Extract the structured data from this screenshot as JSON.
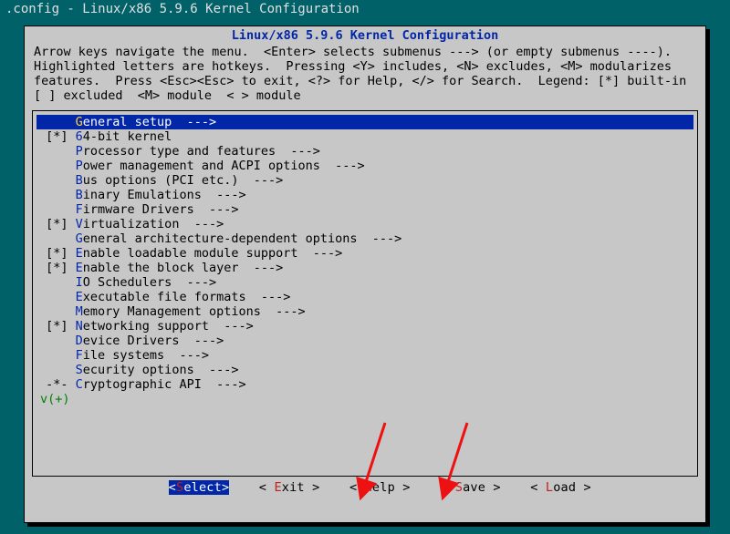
{
  "window_title": ".config - Linux/x86 5.9.6 Kernel Configuration",
  "box_title": "Linux/x86 5.9.6 Kernel Configuration",
  "help_text": "Arrow keys navigate the menu.  <Enter> selects submenus ---> (or empty submenus ----).  Highlighted letters are hotkeys.  Pressing <Y> includes, <N> excludes, <M> modularizes features.  Press <Esc><Esc> to exit, <?> for Help, </> for Search.  Legend: [*] built-in  [ ] excluded  <M> module  < > module",
  "menu": [
    {
      "marker": "   ",
      "hot": "G",
      "rest": "eneral setup  --->",
      "selected": true
    },
    {
      "marker": "[*]",
      "hot": "6",
      "rest": "4-bit kernel"
    },
    {
      "marker": "   ",
      "hot": "P",
      "rest": "rocessor type and features  --->"
    },
    {
      "marker": "   ",
      "hot": "P",
      "rest": "ower management and ACPI options  --->"
    },
    {
      "marker": "   ",
      "hot": "B",
      "rest": "us options (PCI etc.)  --->"
    },
    {
      "marker": "   ",
      "hot": "B",
      "rest": "inary Emulations  --->"
    },
    {
      "marker": "   ",
      "hot": "F",
      "rest": "irmware Drivers  --->"
    },
    {
      "marker": "[*]",
      "hot": "V",
      "rest": "irtualization  --->"
    },
    {
      "marker": "   ",
      "hot": "G",
      "rest": "eneral architecture-dependent options  --->"
    },
    {
      "marker": "[*]",
      "hot": "E",
      "rest": "nable loadable module support  --->"
    },
    {
      "marker": "[*]",
      "hot": "E",
      "rest": "nable the block layer  --->"
    },
    {
      "marker": "   ",
      "hot": "I",
      "rest": "O Schedulers  --->"
    },
    {
      "marker": "   ",
      "hot": "E",
      "rest": "xecutable file formats  --->"
    },
    {
      "marker": "   ",
      "hot": "M",
      "rest": "emory Management options  --->"
    },
    {
      "marker": "[*]",
      "hot": "N",
      "rest": "etworking support  --->"
    },
    {
      "marker": "   ",
      "hot": "D",
      "rest": "evice Drivers  --->"
    },
    {
      "marker": "   ",
      "hot": "F",
      "rest": "ile systems  --->"
    },
    {
      "marker": "   ",
      "hot": "S",
      "rest": "ecurity options  --->"
    },
    {
      "marker": "-*-",
      "hot": "C",
      "rest": "ryptographic API  --->"
    }
  ],
  "more_indicator": "v(+)",
  "buttons": {
    "select": {
      "open": "<",
      "hot": "S",
      "rest": "elect",
      "close": ">"
    },
    "exit": {
      "open": "< ",
      "hot": "E",
      "rest": "xit ",
      "close": ">"
    },
    "help": {
      "open": "< ",
      "hot": "H",
      "rest": "elp ",
      "close": ">"
    },
    "save": {
      "open": "< ",
      "hot": "S",
      "rest": "ave ",
      "close": ">"
    },
    "load": {
      "open": "< ",
      "hot": "L",
      "rest": "oad ",
      "close": ">"
    }
  }
}
